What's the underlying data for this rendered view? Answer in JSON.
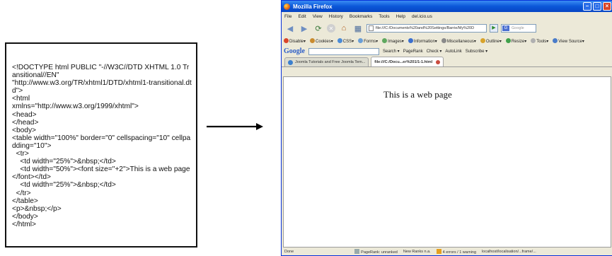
{
  "code_box": {
    "lines": "<!DOCTYPE html PUBLIC \"-//W3C//DTD XHTML 1.0 Transitional//EN\"\n\"http://www.w3.org/TR/xhtml1/DTD/xhtml1-transitional.dtd\">\n<html\nxmlns=\"http://www.w3.org/1999/xhtml\">\n<head>\n</head>\n<body>\n<table width=\"100%\" border=\"0\" cellspacing=\"10\" cellpadding=\"10\">\n  <tr>\n    <td width=\"25%\">&nbsp;</td>\n    <td width=\"50%\"><font size=\"+2\">This is a web page</font></td>\n    <td width=\"25%\">&nbsp;</td>\n  </tr>\n</table>\n<p>&nbsp;</p>\n</body>\n</html>"
  },
  "browser": {
    "title": "Mozilla Firefox",
    "menu": [
      "File",
      "Edit",
      "View",
      "History",
      "Bookmarks",
      "Tools",
      "Help",
      "del.icio.us"
    ],
    "url": "file:///C:/Documents%20and%20Settings/Barrie/My%20D",
    "search_placeholder": "Google",
    "toolbar_items": [
      "Disable▾",
      "Cookies▾",
      "CSS▾",
      "Forms▾",
      "Images▾",
      "Information▾",
      "Miscellaneous▾",
      "Outline▾",
      "Resize▾",
      "Tools▾",
      "View Source▾"
    ],
    "googlebar_items": [
      "Search ▾",
      "PageRank",
      "Check ▾",
      "AutoLink",
      "Subscribe ▾"
    ],
    "google_logo": "Google",
    "tabs": [
      {
        "label": "Joomla Tutorials and Free Joomla Tem...",
        "active": false
      },
      {
        "label": "file:///C:/Docu...er%201/1-1.html",
        "active": true
      }
    ],
    "page_text": "This is a web page",
    "status": {
      "left": "Done",
      "items": [
        "PageRank: unranked",
        "New Ranks n.a.",
        "4 errors / 1 warning",
        "localhost/localisation/...frame/..."
      ]
    }
  },
  "colors": {
    "titlebar": "#0a56d8",
    "window_chrome": "#ece9d8",
    "arrow": "#000000"
  }
}
